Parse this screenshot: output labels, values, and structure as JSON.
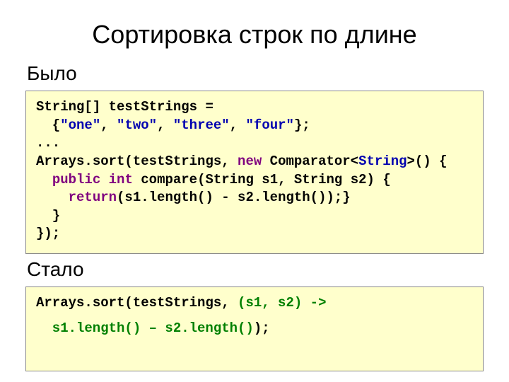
{
  "title": "Сортировка строк по длине",
  "label_before": "Было",
  "label_after": "Стало",
  "code1": {
    "l1a": "String[] testStrings =",
    "l2a": "  {",
    "l2q1": "\"one\"",
    "l2c1": ", ",
    "l2q2": "\"two\"",
    "l2c2": ", ",
    "l2q3": "\"three\"",
    "l2c3": ", ",
    "l2q4": "\"four\"",
    "l2b": "};",
    "l3": "...",
    "l4a": "Arrays.sort(testStrings, ",
    "l4kw": "new",
    "l4b": " Comparator<",
    "l4type": "String",
    "l4c": ">() {",
    "l5a": "  ",
    "l5kw1": "public",
    "l5s1": " ",
    "l5kw2": "int",
    "l5b": " compare(String s1, String s2) {",
    "l6a": "    ",
    "l6kw": "return",
    "l6b": "(s1.length() - s2.length());}",
    "l7": "  }",
    "l8": "});"
  },
  "code2": {
    "l1a": "Arrays.sort(testStrings, ",
    "l1lam": "(s1, s2) ->",
    "l2lam": "s1.length() – s2.length()",
    "l2b": ");"
  }
}
